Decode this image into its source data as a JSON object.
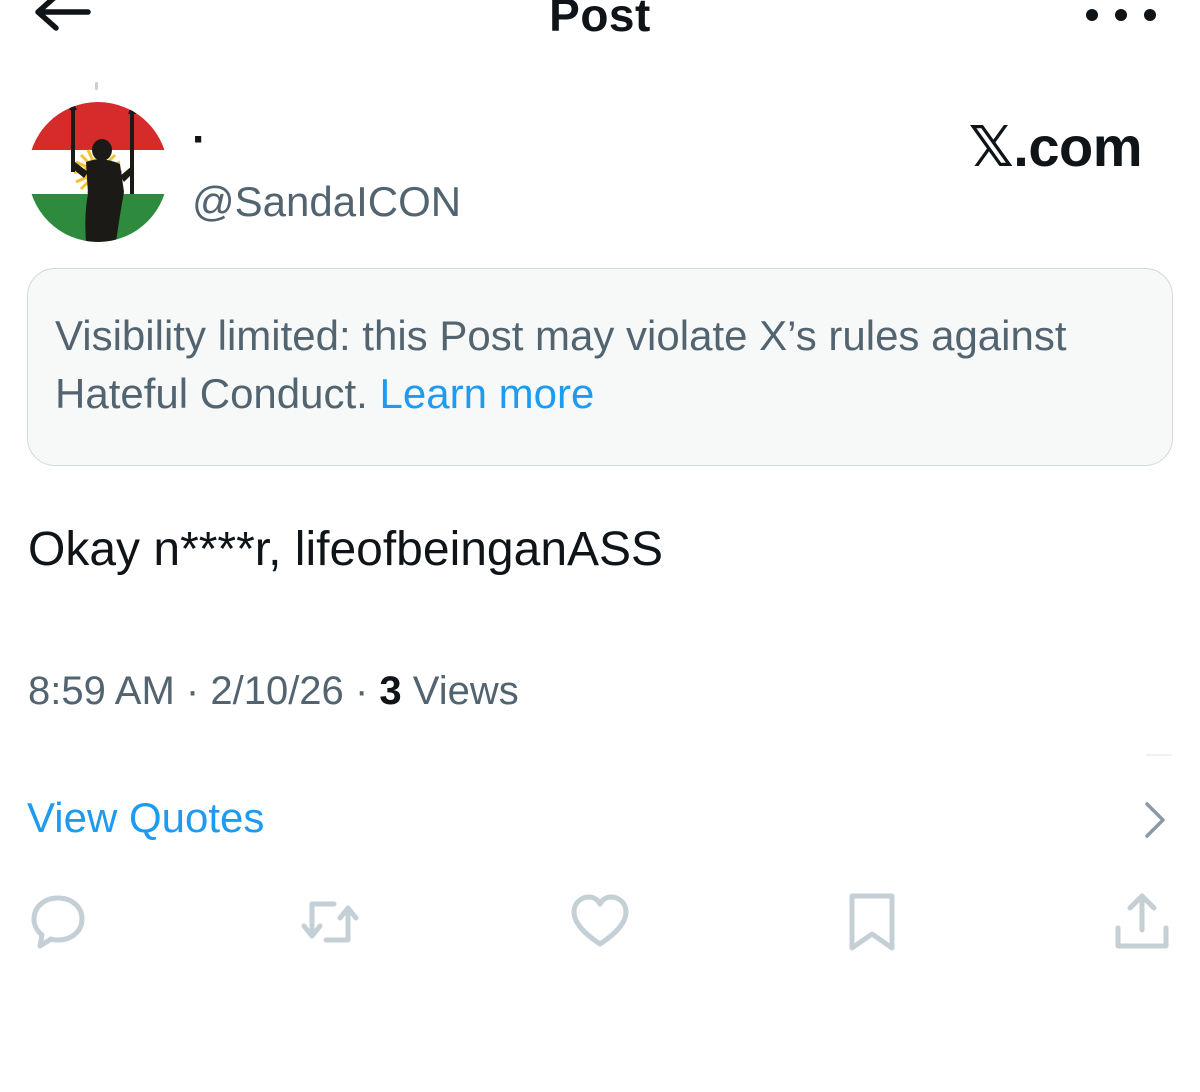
{
  "header": {
    "title": "Post",
    "back_icon": "arrow-left-icon",
    "more_icon": "more-horizontal-icon"
  },
  "author": {
    "display_name": "·",
    "handle": "@SandaICON",
    "avatar": "kurdistan-flag-statue-avatar"
  },
  "watermark": "𝕏.com",
  "notice": {
    "text": "Visibility limited: this Post may violate X’s rules against Hateful Conduct.",
    "link": "Learn more"
  },
  "post": {
    "text": "Okay n****r, lifeofbeinganASS"
  },
  "meta": {
    "time": "8:59 AM",
    "separator": "·",
    "date": "2/10/26",
    "views_count": "3",
    "views_label": "Views"
  },
  "quotes": {
    "label": "View Quotes",
    "icon": "chevron-right-icon"
  },
  "actions": [
    {
      "name": "reply",
      "icon": "reply-icon"
    },
    {
      "name": "repost",
      "icon": "repost-icon"
    },
    {
      "name": "like",
      "icon": "heart-icon"
    },
    {
      "name": "bookmark",
      "icon": "bookmark-icon"
    },
    {
      "name": "share",
      "icon": "share-icon"
    }
  ],
  "colors": {
    "link": "#1d9bf0",
    "secondary_text": "#536471",
    "primary_text": "#0f1419",
    "notice_bg": "#f7f9f9",
    "notice_border": "#cfd9de",
    "icon_gray": "#c4cfd6"
  }
}
